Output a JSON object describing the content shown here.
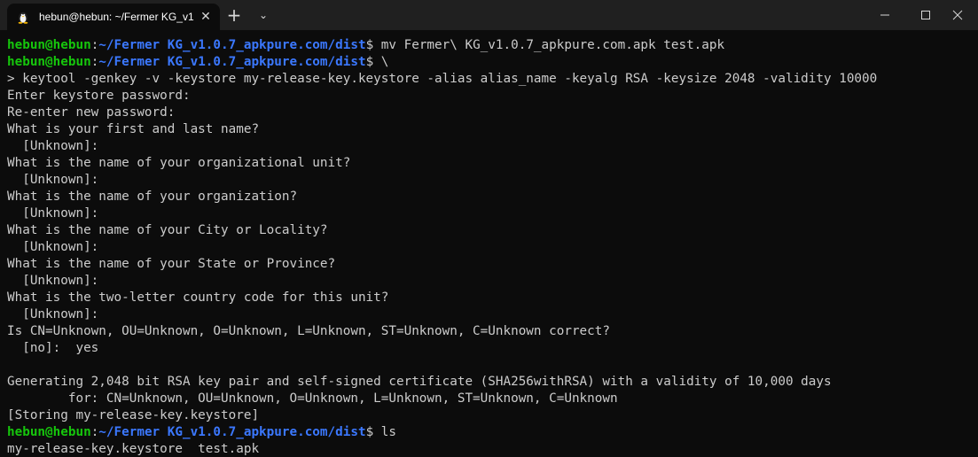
{
  "window": {
    "tab_title": "hebun@hebun: ~/Fermer KG_v1",
    "tab_icon": "linux-tux-icon",
    "tab_close_icon": "close-icon",
    "new_tab_icon": "plus-icon",
    "tab_dropdown_icon": "chevron-down-icon",
    "minimize_icon": "minimize-icon",
    "maximize_icon": "maximize-icon",
    "close_icon": "close-icon"
  },
  "prompt": {
    "user_host": "hebun@hebun",
    "sep": ":",
    "path": "~/Fermer KG_v1.0.7_apkpure.com/dist",
    "symbol": "$"
  },
  "colors": {
    "background": "#0c0c0c",
    "titlebar": "#202020",
    "text": "#cccccc",
    "prompt_user": "#16c60c",
    "prompt_path": "#3b78ff"
  },
  "terminal": {
    "cmd1": " mv Fermer\\ KG_v1.0.7_apkpure.com.apk test.apk",
    "cmd2": " \\",
    "lines_a": [
      "> keytool -genkey -v -keystore my-release-key.keystore -alias alias_name -keyalg RSA -keysize 2048 -validity 10000",
      "Enter keystore password:",
      "Re-enter new password:",
      "What is your first and last name?",
      "  [Unknown]:",
      "What is the name of your organizational unit?",
      "  [Unknown]:",
      "What is the name of your organization?",
      "  [Unknown]:",
      "What is the name of your City or Locality?",
      "  [Unknown]:",
      "What is the name of your State or Province?",
      "  [Unknown]:",
      "What is the two-letter country code for this unit?",
      "  [Unknown]:",
      "Is CN=Unknown, OU=Unknown, O=Unknown, L=Unknown, ST=Unknown, C=Unknown correct?",
      "  [no]:  yes",
      "",
      "Generating 2,048 bit RSA key pair and self-signed certificate (SHA256withRSA) with a validity of 10,000 days",
      "        for: CN=Unknown, OU=Unknown, O=Unknown, L=Unknown, ST=Unknown, C=Unknown",
      "[Storing my-release-key.keystore]"
    ],
    "cmd3": " ls",
    "output_last": "my-release-key.keystore  test.apk"
  }
}
